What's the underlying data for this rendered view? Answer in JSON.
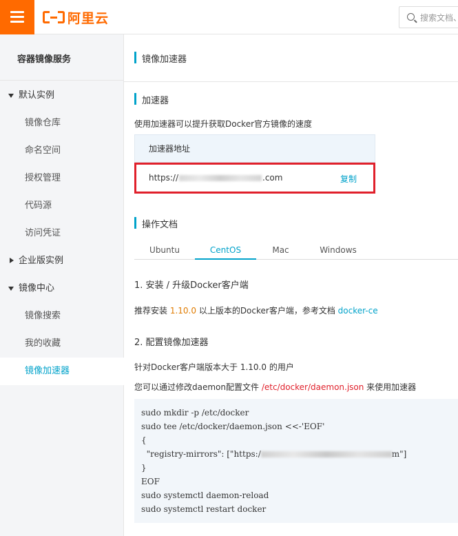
{
  "topbar": {
    "logo_text": "阿里云",
    "search_placeholder": "搜索文档、"
  },
  "sidebar": {
    "title": "容器镜像服务",
    "items": [
      {
        "label": "默认实例",
        "type": "group",
        "expanded": true
      },
      {
        "label": "镜像仓库",
        "type": "sub"
      },
      {
        "label": "命名空间",
        "type": "sub"
      },
      {
        "label": "授权管理",
        "type": "sub"
      },
      {
        "label": "代码源",
        "type": "sub"
      },
      {
        "label": "访问凭证",
        "type": "sub"
      },
      {
        "label": "企业版实例",
        "type": "group",
        "expanded": false
      },
      {
        "label": "镜像中心",
        "type": "group",
        "expanded": true
      },
      {
        "label": "镜像搜索",
        "type": "sub"
      },
      {
        "label": "我的收藏",
        "type": "sub"
      },
      {
        "label": "镜像加速器",
        "type": "sub",
        "active": true
      }
    ]
  },
  "main": {
    "page_title": "镜像加速器",
    "accelerator": {
      "title": "加速器",
      "description": "使用加速器可以提升获取Docker官方镜像的速度",
      "address_header": "加速器地址",
      "url_prefix": "https://",
      "url_suffix": ".com",
      "copy_label": "复制"
    },
    "docs": {
      "title": "操作文档",
      "tabs": [
        "Ubuntu",
        "CentOS",
        "Mac",
        "Windows"
      ],
      "active_tab": "CentOS",
      "step1_title": "1. 安装 / 升级Docker客户端",
      "step1_text_a": "推荐安装 ",
      "step1_version": "1.10.0",
      "step1_text_b": " 以上版本的Docker客户端，参考文档 ",
      "step1_link": "docker-ce",
      "step2_title": "2. 配置镜像加速器",
      "step2_line1": "针对Docker客户端版本大于 1.10.0 的用户",
      "step2_line2_a": "您可以通过修改daemon配置文件 ",
      "step2_path": "/etc/docker/daemon.json",
      "step2_line2_b": " 来使用加速器",
      "code_lines": [
        "sudo mkdir -p /etc/docker",
        "sudo tee /etc/docker/daemon.json <<-'EOF'",
        "{",
        "  \"registry-mirrors\": [\"https:/",
        "}",
        "EOF",
        "sudo systemctl daemon-reload",
        "sudo systemctl restart docker"
      ],
      "code_mirror_suffix": "m\"]"
    }
  },
  "colors": {
    "brand": "#ff6a00",
    "accent": "#00a2ca",
    "highlight_border": "#e0202b"
  }
}
